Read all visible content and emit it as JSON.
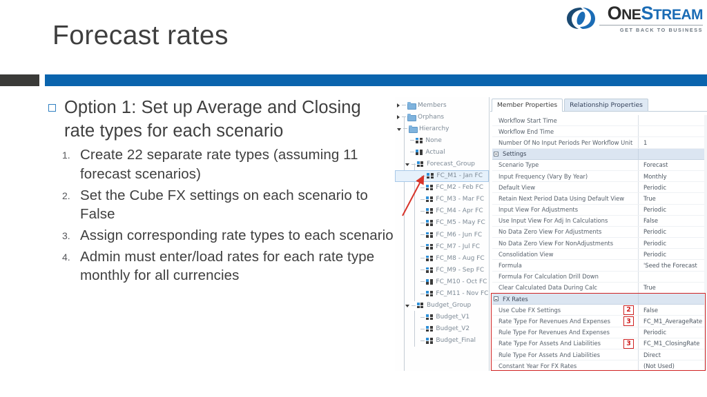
{
  "logo": {
    "word_one": "One",
    "word_stream": "Stream",
    "tagline": "GET BACK TO BUSINESS",
    "mark": "onestream-swirl-logo",
    "brand_blue": "#1b6cb5",
    "brand_dark": "#2b2b2b"
  },
  "slide": {
    "title": "Forecast rates",
    "accent_bar_color": "#0a64ad",
    "accent_bar_dark_color": "#3a3a38",
    "bullet_marker": "hollow-square"
  },
  "content": {
    "level1": "Option 1: Set up Average and Closing rate types for each scenario",
    "steps": [
      {
        "num": "1.",
        "text": "Create 22 separate rate types (assuming 11 forecast scenarios)"
      },
      {
        "num": "2.",
        "text": "Set the Cube FX settings on each scenario to False"
      },
      {
        "num": "3.",
        "text": "Assign corresponding rate types to each scenario"
      },
      {
        "num": "4.",
        "text": "Admin must enter/load rates for each rate type monthly for all currencies"
      }
    ]
  },
  "screenshot": {
    "tree": {
      "items": [
        {
          "label": "Members",
          "indent": 0,
          "toggle": "collapsed",
          "icon": "folder-icon"
        },
        {
          "label": "Orphans",
          "indent": 0,
          "toggle": "collapsed",
          "icon": "folder-icon"
        },
        {
          "label": "Hierarchy",
          "indent": 0,
          "toggle": "expanded",
          "icon": "folder-icon"
        },
        {
          "label": "None",
          "indent": 1,
          "toggle": "leaf",
          "icon": "member-icon"
        },
        {
          "label": "Actual",
          "indent": 1,
          "toggle": "leaf",
          "icon": "member-icon"
        },
        {
          "label": "Forecast_Group",
          "indent": 1,
          "toggle": "expanded",
          "icon": "member-icon"
        },
        {
          "label": "FC_M1 - Jan FC",
          "indent": 2,
          "toggle": "leaf",
          "icon": "member-icon",
          "selected": true
        },
        {
          "label": "FC_M2 - Feb FC",
          "indent": 2,
          "toggle": "leaf",
          "icon": "member-icon"
        },
        {
          "label": "FC_M3 - Mar FC",
          "indent": 2,
          "toggle": "leaf",
          "icon": "member-icon"
        },
        {
          "label": "FC_M4 - Apr FC",
          "indent": 2,
          "toggle": "leaf",
          "icon": "member-icon"
        },
        {
          "label": "FC_M5 - May FC",
          "indent": 2,
          "toggle": "leaf",
          "icon": "member-icon"
        },
        {
          "label": "FC_M6 - Jun FC",
          "indent": 2,
          "toggle": "leaf",
          "icon": "member-icon"
        },
        {
          "label": "FC_M7 - Jul FC",
          "indent": 2,
          "toggle": "leaf",
          "icon": "member-icon"
        },
        {
          "label": "FC_M8 - Aug FC",
          "indent": 2,
          "toggle": "leaf",
          "icon": "member-icon"
        },
        {
          "label": "FC_M9 - Sep FC",
          "indent": 2,
          "toggle": "leaf",
          "icon": "member-icon"
        },
        {
          "label": "FC_M10 - Oct FC",
          "indent": 2,
          "toggle": "leaf",
          "icon": "member-icon"
        },
        {
          "label": "FC_M11 - Nov FC",
          "indent": 2,
          "toggle": "leaf",
          "icon": "member-icon"
        },
        {
          "label": "Budget_Group",
          "indent": 1,
          "toggle": "expanded",
          "icon": "member-icon"
        },
        {
          "label": "Budget_V1",
          "indent": 2,
          "toggle": "leaf",
          "icon": "member-icon"
        },
        {
          "label": "Budget_V2",
          "indent": 2,
          "toggle": "leaf",
          "icon": "member-icon"
        },
        {
          "label": "Budget_Final",
          "indent": 2,
          "toggle": "leaf",
          "icon": "member-icon"
        }
      ]
    },
    "tabs": [
      {
        "label": "Member Properties",
        "active": true
      },
      {
        "label": "Relationship Properties",
        "active": false
      }
    ],
    "properties": [
      {
        "name": "Workflow Start Time",
        "value": "",
        "group": false
      },
      {
        "name": "Workflow End Time",
        "value": "",
        "group": false
      },
      {
        "name": "Number Of No Input Periods Per Workflow Unit",
        "value": "1",
        "group": false
      },
      {
        "name": "Settings",
        "value": "",
        "group": true
      },
      {
        "name": "Scenario Type",
        "value": "Forecast",
        "group": false
      },
      {
        "name": "Input Frequency (Vary By Year)",
        "value": "Monthly",
        "group": false
      },
      {
        "name": "Default View",
        "value": "Periodic",
        "group": false
      },
      {
        "name": "Retain Next Period Data Using Default View",
        "value": "True",
        "group": false
      },
      {
        "name": "Input View For Adjustments",
        "value": "Periodic",
        "group": false
      },
      {
        "name": "Use Input View For Adj In Calculations",
        "value": "False",
        "group": false
      },
      {
        "name": "No Data Zero View For Adjustments",
        "value": "Periodic",
        "group": false
      },
      {
        "name": "No Data Zero View For NonAdjustments",
        "value": "Periodic",
        "group": false
      },
      {
        "name": "Consolidation View",
        "value": "Periodic",
        "group": false
      },
      {
        "name": "Formula",
        "value": "'Seed the Forecast",
        "group": false
      },
      {
        "name": "Formula For Calculation Drill Down",
        "value": "",
        "group": false
      },
      {
        "name": "Clear Calculated Data During Calc",
        "value": "True",
        "group": false
      },
      {
        "name": "FX Rates",
        "value": "",
        "group": true
      },
      {
        "name": "Use Cube FX Settings",
        "value": "False",
        "group": false,
        "callout": "2"
      },
      {
        "name": "Rate Type For Revenues And Expenses",
        "value": "FC_M1_AverageRate",
        "group": false,
        "callout": "3"
      },
      {
        "name": "Rule Type For Revenues And Expenses",
        "value": "Periodic",
        "group": false
      },
      {
        "name": "Rate Type For Assets And Liabilities",
        "value": "FC_M1_ClosingRate",
        "group": false,
        "callout": "3"
      },
      {
        "name": "Rule Type For Assets And Liabilities",
        "value": "Direct",
        "group": false
      },
      {
        "name": "Constant Year For FX Rates",
        "value": "(Not Used)",
        "group": false
      }
    ],
    "annotations": {
      "highlight_color": "#d02020",
      "pointer": "red-arrow-to-fc-m1"
    }
  }
}
